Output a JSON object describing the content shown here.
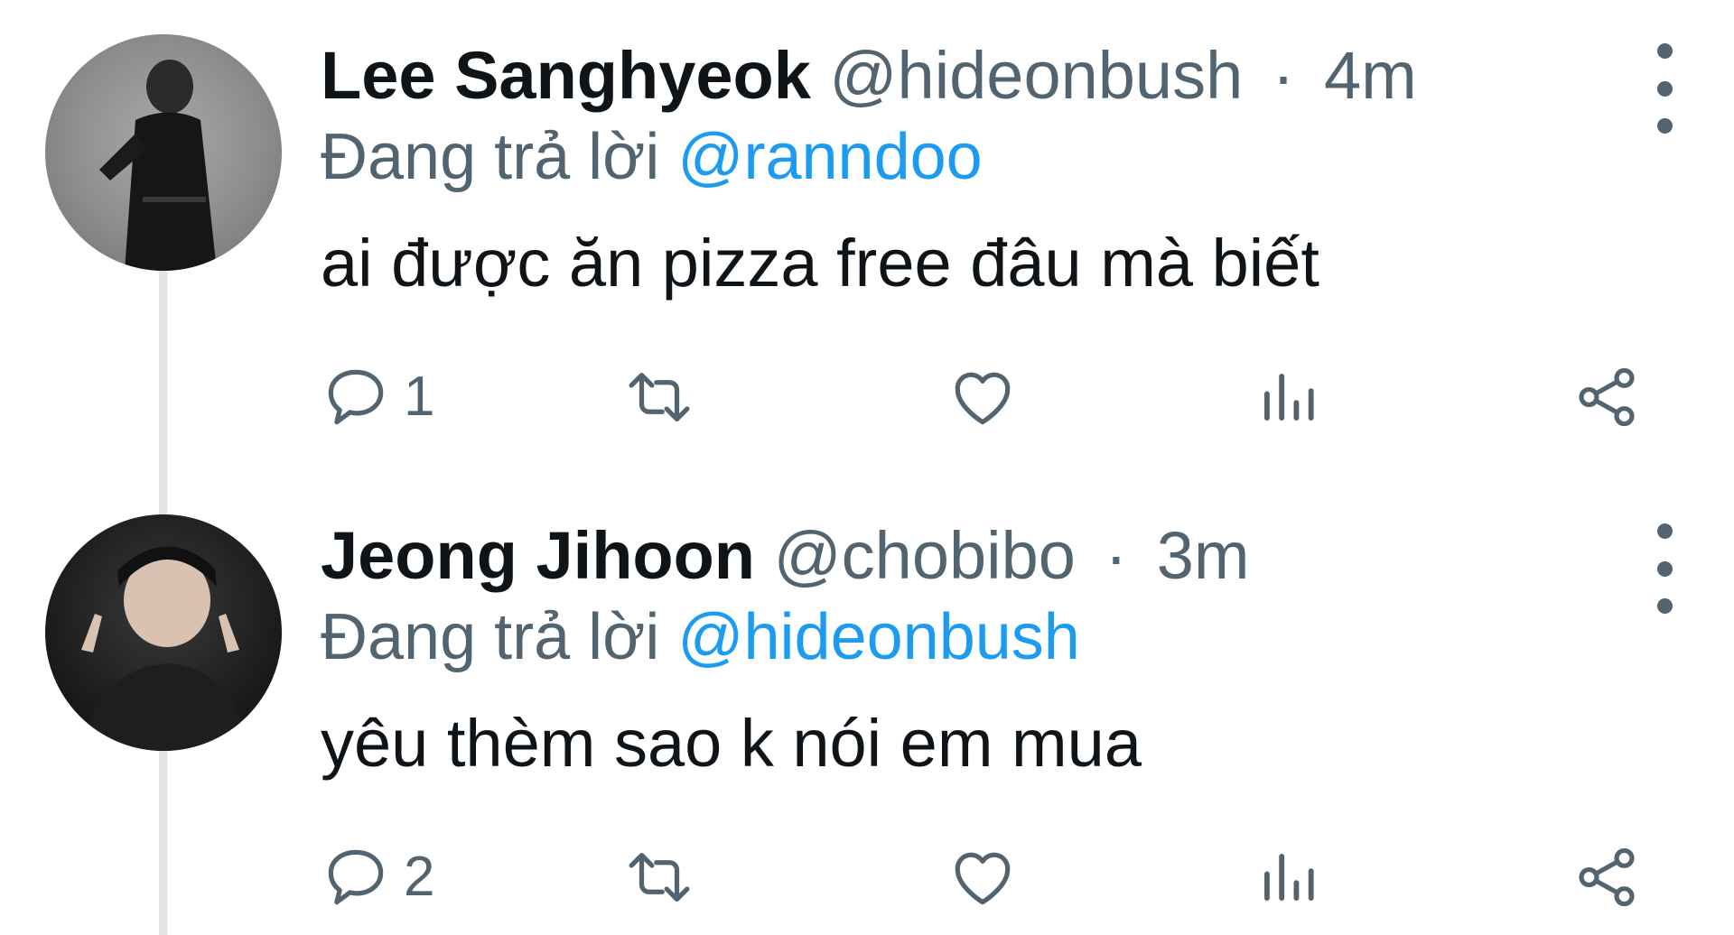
{
  "tweets": [
    {
      "name": "Lee Sanghyeok",
      "handle": "@hideonbush",
      "separator": "·",
      "time": "4m",
      "reply_prefix": "Đang trả lời",
      "reply_to": "@ranndoo",
      "text": "ai được ăn pizza free đâu mà biết",
      "reply_count": "1"
    },
    {
      "name": "Jeong Jihoon",
      "handle": "@chobibo",
      "separator": "·",
      "time": "3m",
      "reply_prefix": "Đang trả lời",
      "reply_to": "@hideonbush",
      "text": "yêu thèm sao k nói em mua",
      "reply_count": "2"
    }
  ],
  "icons": {
    "reply": "speech-bubble-icon",
    "retweet": "retweet-arrows-icon",
    "like": "heart-icon",
    "views": "bar-chart-icon",
    "share": "share-nodes-icon",
    "more": "vertical-ellipsis-icon"
  },
  "colors": {
    "text_primary": "#0f1419",
    "text_secondary": "#536471",
    "mention": "#1d9bf0",
    "thread_line": "#e2e5e8"
  }
}
